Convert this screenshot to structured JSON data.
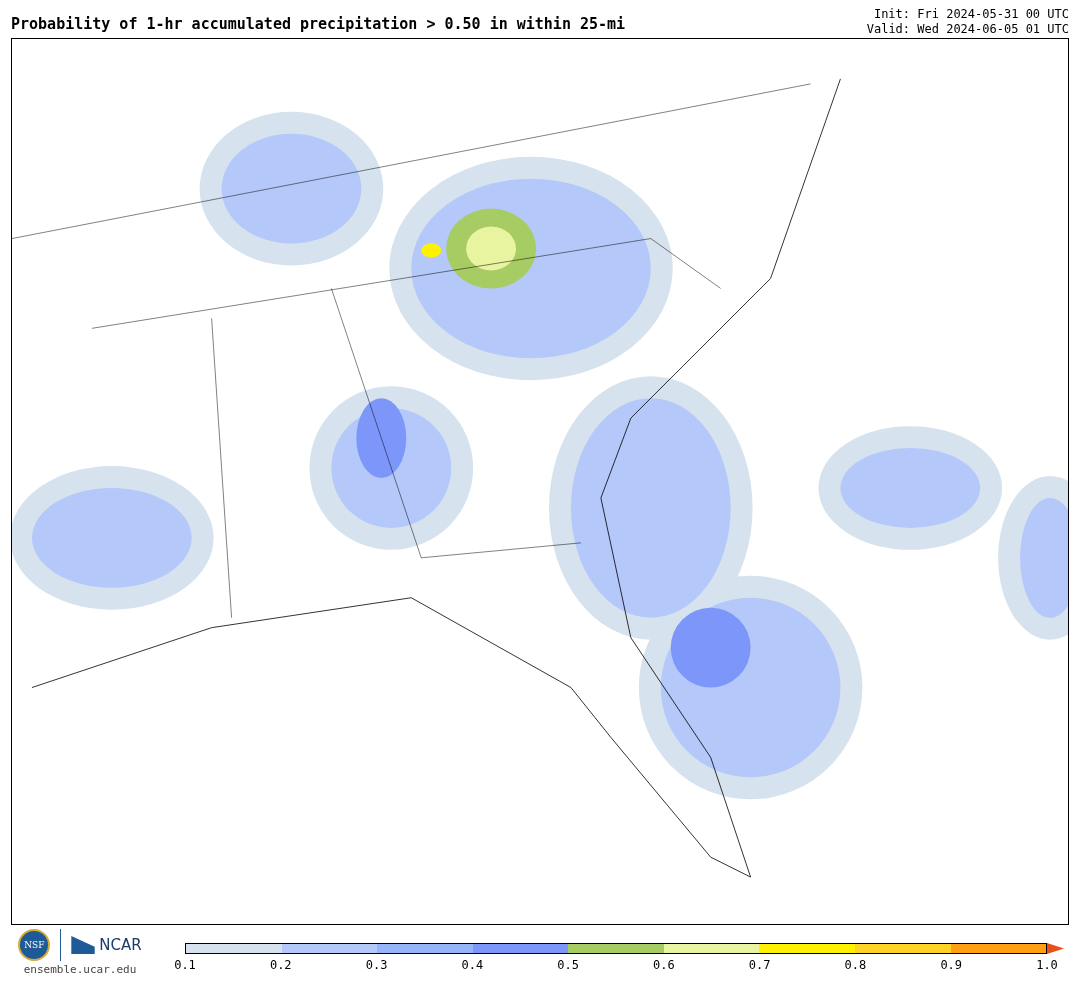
{
  "title": "Probability of 1-hr accumulated precipitation > 0.50 in within 25-mi",
  "init": "Init: Fri 2024-05-31 00 UTC",
  "valid": "Valid: Wed 2024-06-05 01 UTC",
  "logos": {
    "nsf": "NSF",
    "ncar": "NCAR",
    "url": "ensemble.ucar.edu"
  },
  "colorbar": {
    "segments": [
      {
        "color": "#d6e2ee"
      },
      {
        "color": "#b4c8fa"
      },
      {
        "color": "#96b4fa"
      },
      {
        "color": "#7d96fa"
      },
      {
        "color": "#a8cc64"
      },
      {
        "color": "#e8f4a0"
      },
      {
        "color": "#fff200"
      },
      {
        "color": "#ffd228"
      },
      {
        "color": "#ffa014"
      }
    ],
    "extension": {
      "color": "#e8501a"
    },
    "ticks": [
      "0.1",
      "0.2",
      "0.3",
      "0.4",
      "0.5",
      "0.6",
      "0.7",
      "0.8",
      "0.9",
      "1.0"
    ]
  }
}
